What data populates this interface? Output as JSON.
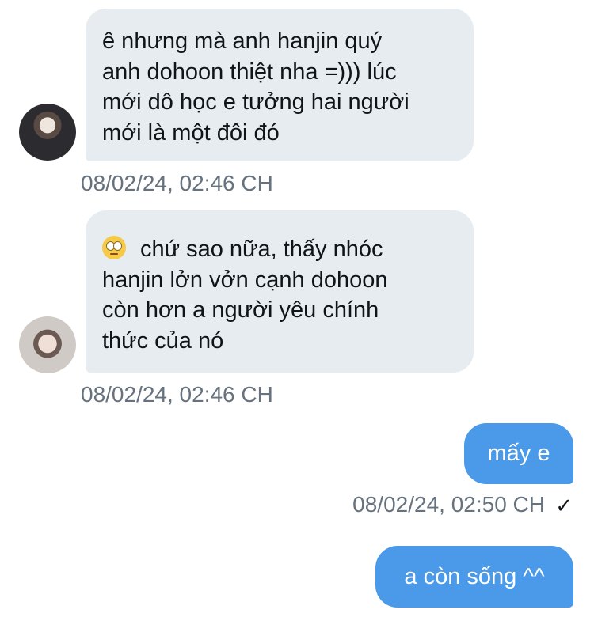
{
  "messages": [
    {
      "direction": "incoming",
      "lines": [
        "ê nhưng mà anh hanjin quý",
        "anh dohoon thiệt nha =))) lúc",
        "mới dô học e tưởng hai người",
        "mới là một đôi đó"
      ],
      "timestamp": "08/02/24, 02:46 CH"
    },
    {
      "direction": "incoming",
      "emoji": "eye-roll-emoji-icon",
      "lines": [
        "chứ sao nữa, thấy nhóc",
        "hanjin lởn vởn cạnh dohoon",
        "còn hơn a người yêu chính",
        "thức của nó"
      ],
      "timestamp": "08/02/24, 02:46 CH"
    },
    {
      "direction": "outgoing",
      "text": "mấy e",
      "timestamp": "08/02/24, 02:50 CH",
      "status_icon": "✓"
    },
    {
      "direction": "outgoing",
      "text": "a còn sống ^^"
    }
  ],
  "colors": {
    "incoming_bubble": "#e7ecf0",
    "outgoing_bubble": "#4a9ae9",
    "timestamp": "#66727e",
    "text": "#0f1419"
  }
}
